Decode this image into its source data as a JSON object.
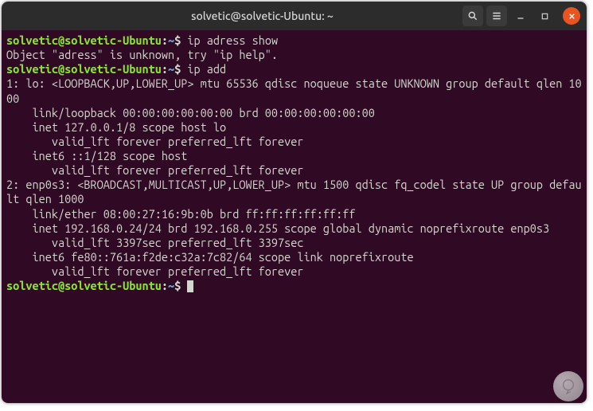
{
  "window": {
    "title": "solvetic@solvetic-Ubuntu: ~"
  },
  "prompt": {
    "user_host": "solvetic@solvetic-Ubuntu",
    "sep": ":",
    "path": "~",
    "dollar": "$"
  },
  "lines": {
    "cmd1": " ip adress show",
    "out1": "Object \"adress\" is unknown, try \"ip help\".",
    "cmd2": " ip add",
    "out2": "1: lo: <LOOPBACK,UP,LOWER_UP> mtu 65536 qdisc noqueue state UNKNOWN group default qlen 1000",
    "out3": "    link/loopback 00:00:00:00:00:00 brd 00:00:00:00:00:00",
    "out4": "    inet 127.0.0.1/8 scope host lo",
    "out5": "       valid_lft forever preferred_lft forever",
    "out6": "    inet6 ::1/128 scope host ",
    "out7": "       valid_lft forever preferred_lft forever",
    "out8": "2: enp0s3: <BROADCAST,MULTICAST,UP,LOWER_UP> mtu 1500 qdisc fq_codel state UP group default qlen 1000",
    "out9": "    link/ether 08:00:27:16:9b:0b brd ff:ff:ff:ff:ff:ff",
    "out10": "    inet 192.168.0.24/24 brd 192.168.0.255 scope global dynamic noprefixroute enp0s3",
    "out11": "       valid_lft 3397sec preferred_lft 3397sec",
    "out12": "    inet6 fe80::761a:f2de:c32a:7c82/64 scope link noprefixroute ",
    "out13": "       valid_lft forever preferred_lft forever"
  },
  "icons": {
    "search": "search-icon",
    "menu": "menu-icon",
    "minimize": "minimize-icon",
    "maximize": "maximize-icon",
    "close": "close-icon"
  }
}
